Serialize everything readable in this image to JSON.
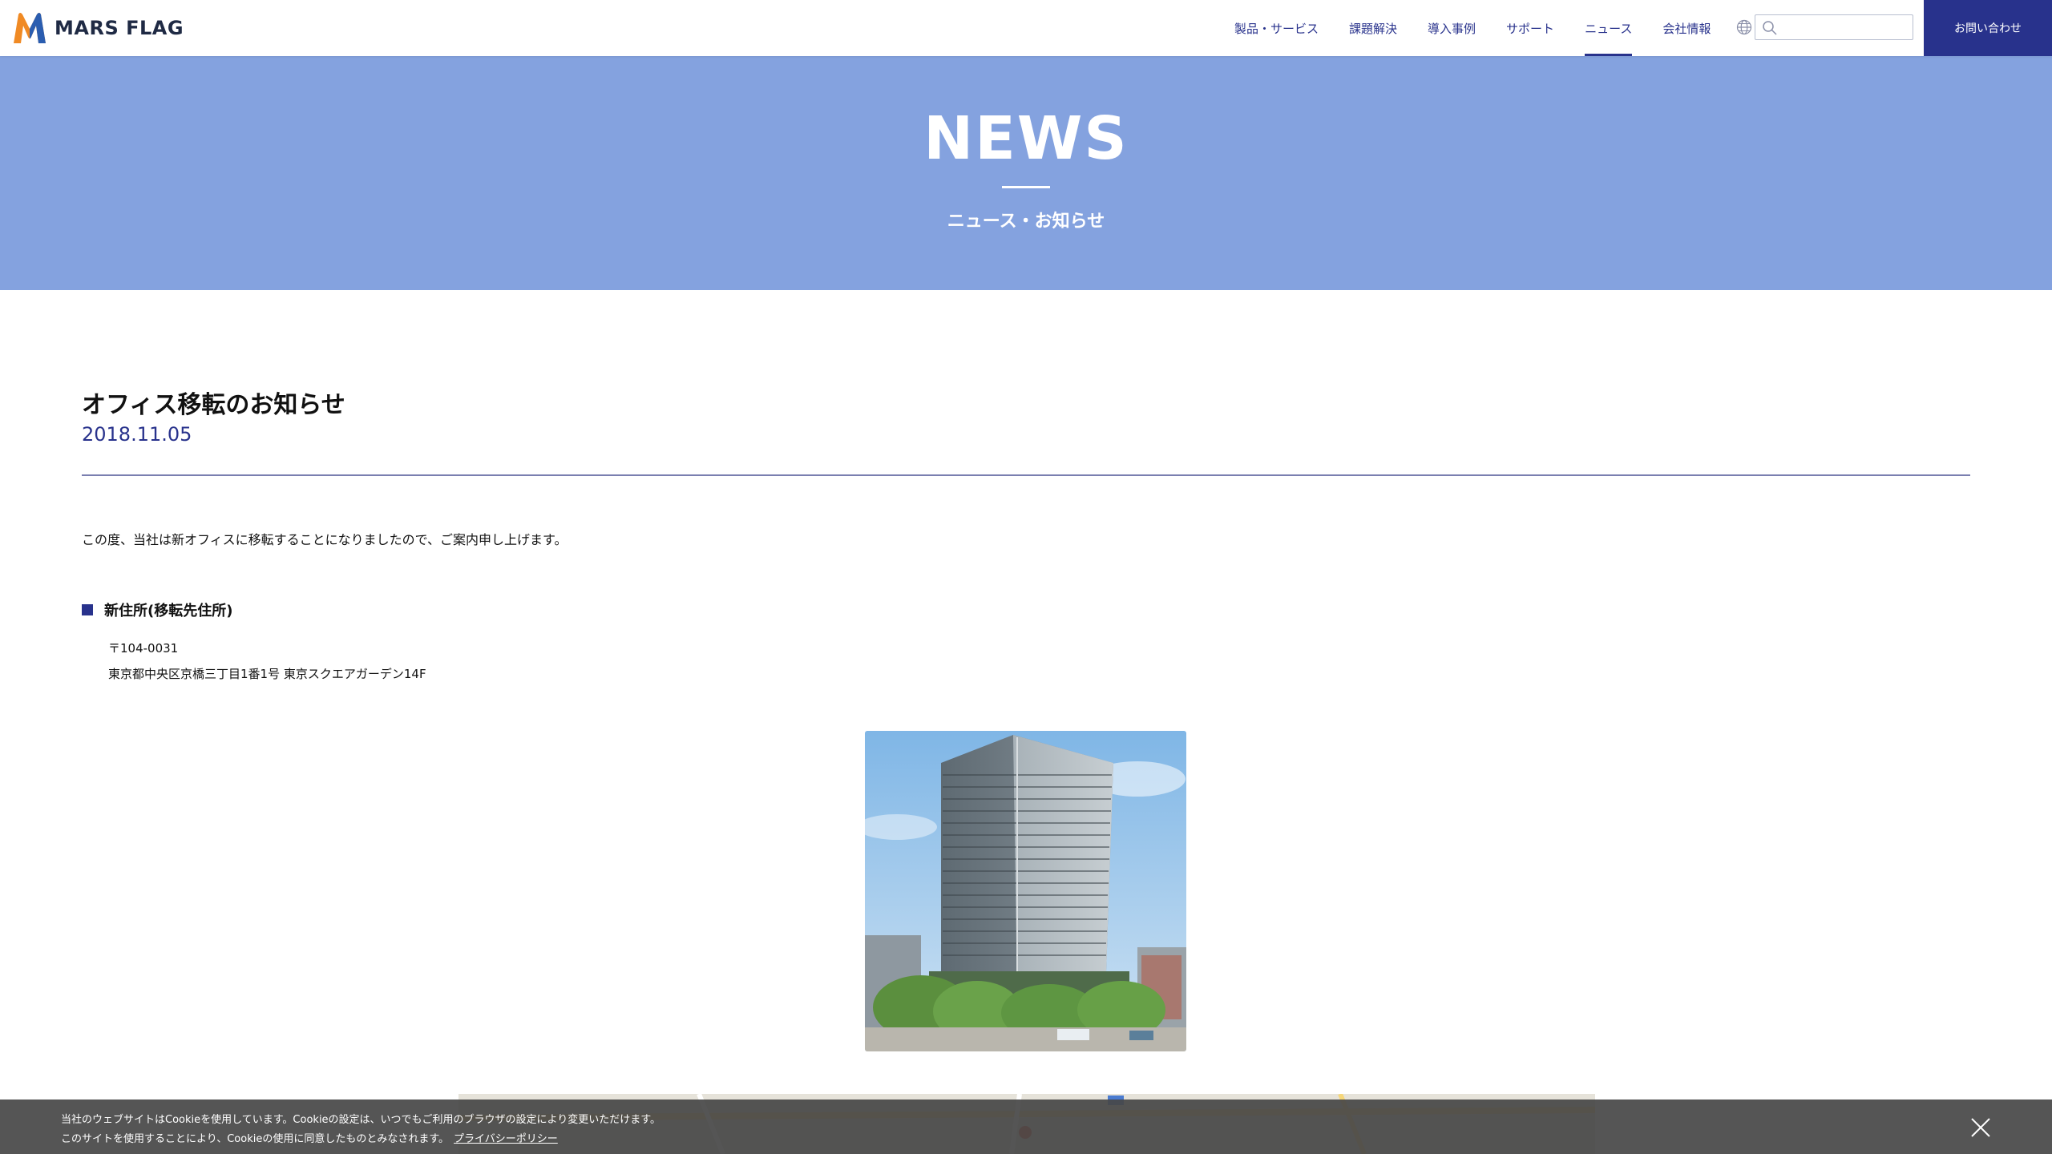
{
  "header": {
    "logo_text": "MARS FLAG",
    "nav": [
      {
        "label": "製品・サービス"
      },
      {
        "label": "課題解決"
      },
      {
        "label": "導入事例"
      },
      {
        "label": "サポート"
      },
      {
        "label": "ニュース",
        "active": true
      },
      {
        "label": "会社情報"
      }
    ],
    "search_placeholder": "",
    "contact_label": "お問い合わせ",
    "icons": {
      "globe": "globe-icon",
      "search": "search-icon"
    },
    "accent_color": "#28328c"
  },
  "hero": {
    "title": "NEWS",
    "subtitle": "ニュース・お知らせ",
    "background": "#84a2df"
  },
  "article": {
    "title": "オフィス移転のお知らせ",
    "date": "2018.11.05",
    "intro": "この度、当社は新オフィスに移転することになりましたので、ご案内申し上げます。",
    "section_heading": "新住所(移転先住所)",
    "postal_code": "〒104-0031",
    "address": "東京都中央区京橋三丁目1番1号 東京スクエアガーデン14F"
  },
  "cookie": {
    "line1": "当社のウェブサイトはCookieを使用しています。Cookieの設定は、いつでもご利用のブラウザの設定により変更いただけます。",
    "line2": "このサイトを使用することにより、Cookieの使用に同意したものとみなされます。",
    "policy_link": "プライバシーポリシー"
  }
}
